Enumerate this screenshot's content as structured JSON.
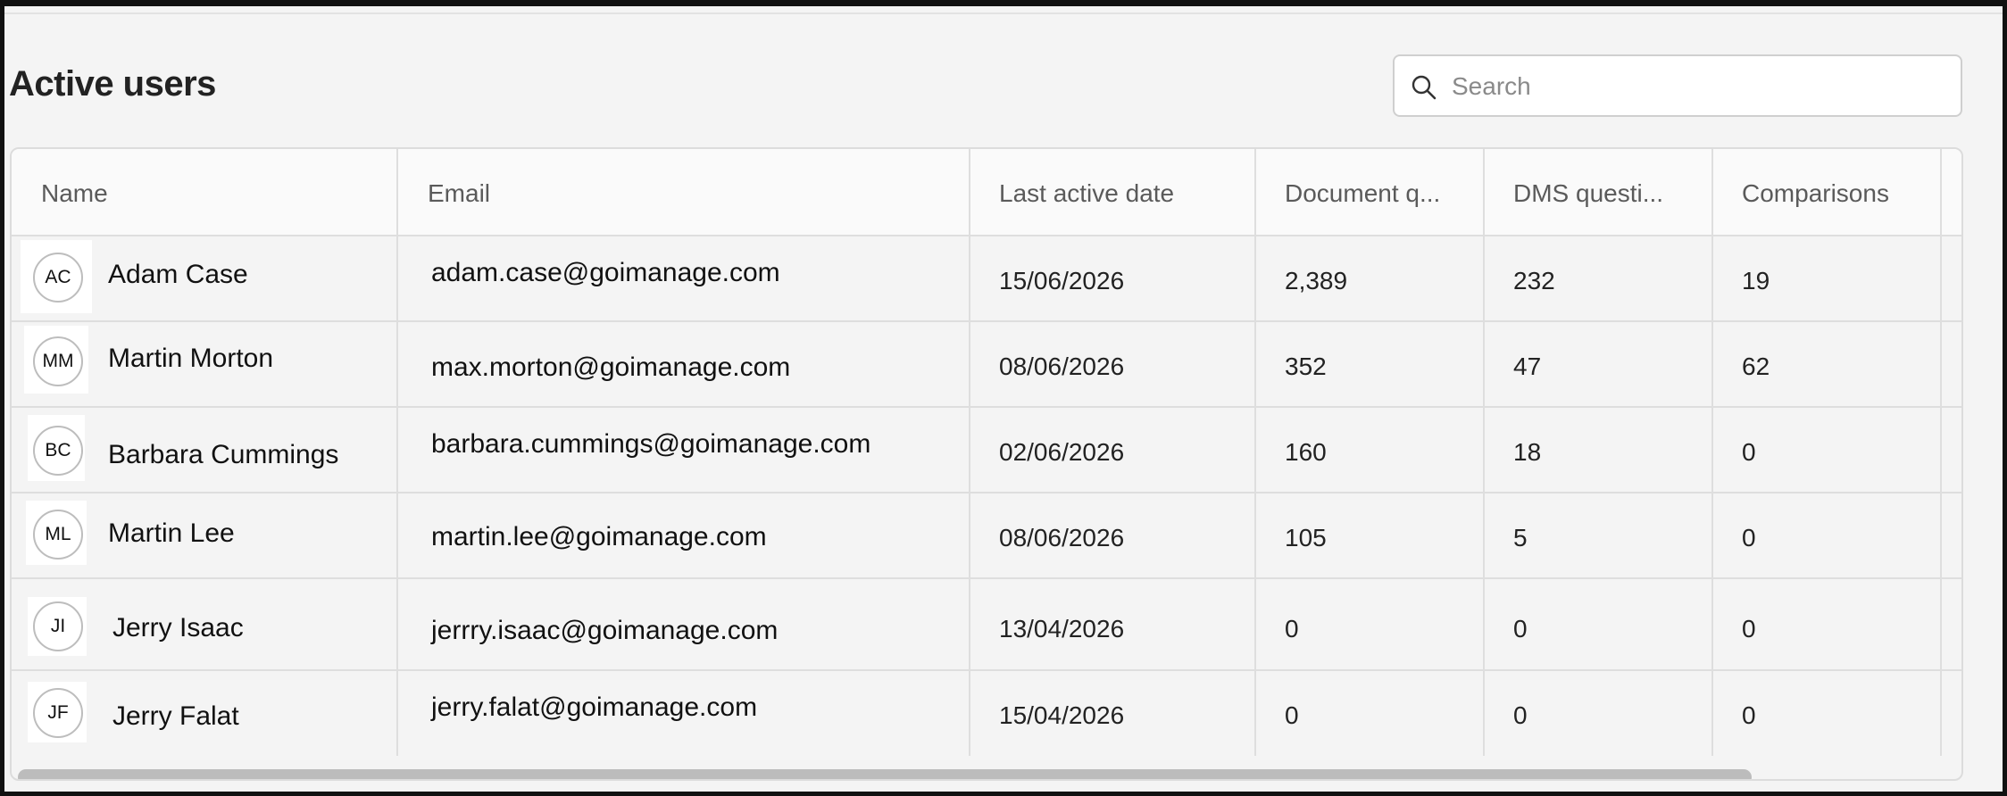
{
  "page": {
    "title": "Active users"
  },
  "search": {
    "placeholder": "Search",
    "value": ""
  },
  "icons": {
    "search": "search-icon"
  },
  "table": {
    "columns": [
      "Name",
      "Email",
      "Last active date",
      "Document q...",
      "DMS questi...",
      "Comparisons"
    ],
    "rows": [
      {
        "initials": "AC",
        "name": "Adam Case",
        "email": "adam.case@goimanage.com",
        "last_active": "15/06/2026",
        "document_q": "2,389",
        "dms_questions": "232",
        "comparisons": "19"
      },
      {
        "initials": "MM",
        "name": "Martin Morton",
        "email": "max.morton@goimanage.com",
        "last_active": "08/06/2026",
        "document_q": "352",
        "dms_questions": "47",
        "comparisons": "62"
      },
      {
        "initials": "BC",
        "name": "Barbara Cummings",
        "email": "barbara.cummings@goimanage.com",
        "last_active": "02/06/2026",
        "document_q": "160",
        "dms_questions": "18",
        "comparisons": "0"
      },
      {
        "initials": "ML",
        "name": "Martin Lee",
        "email": "martin.lee@goimanage.com",
        "last_active": "08/06/2026",
        "document_q": "105",
        "dms_questions": "5",
        "comparisons": "0"
      },
      {
        "initials": "JI",
        "name": "Jerry Isaac",
        "email": "jerrry.isaac@goimanage.com",
        "last_active": "13/04/2026",
        "document_q": "0",
        "dms_questions": "0",
        "comparisons": "0"
      },
      {
        "initials": "JF",
        "name": "Jerry Falat",
        "email": "jerry.falat@goimanage.com",
        "last_active": "15/04/2026",
        "document_q": "0",
        "dms_questions": "0",
        "comparisons": "0"
      }
    ]
  }
}
